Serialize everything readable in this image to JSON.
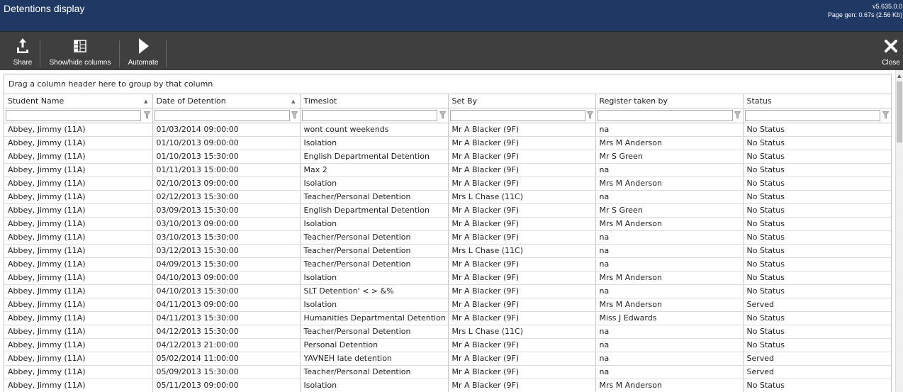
{
  "header": {
    "title": "Detentions display",
    "version": "v5.635.0.0",
    "page_gen": "Page gen: 0.67s (2.56 Kb)"
  },
  "toolbar": {
    "share": {
      "label": "Share",
      "icon": "share-icon"
    },
    "show_hide": {
      "label": "Show/hide columns",
      "icon": "columns-icon"
    },
    "automate": {
      "label": "Automate",
      "icon": "play-icon"
    },
    "close": {
      "label": "Close",
      "icon": "close-icon"
    }
  },
  "grid": {
    "group_panel": "Drag a column header here to group by that column",
    "columns": [
      {
        "label": "Student Name",
        "sorted": "asc"
      },
      {
        "label": "Date of Detention",
        "sorted": "asc"
      },
      {
        "label": "Timeslot",
        "sorted": null
      },
      {
        "label": "Set By",
        "sorted": null
      },
      {
        "label": "Register taken by",
        "sorted": null
      },
      {
        "label": "Status",
        "sorted": null
      }
    ],
    "filters": [
      "",
      "",
      "",
      "",
      "",
      ""
    ],
    "rows": [
      [
        "Abbey, Jimmy (11A)",
        "01/03/2014 09:00:00",
        "wont count weekends",
        "Mr A Blacker (9F)",
        "na",
        "No Status"
      ],
      [
        "Abbey, Jimmy (11A)",
        "01/10/2013 09:00:00",
        "Isolation",
        "Mr A Blacker (9F)",
        "Mrs M Anderson",
        "No Status"
      ],
      [
        "Abbey, Jimmy (11A)",
        "01/10/2013 15:30:00",
        "English Departmental Detention",
        "Mr A Blacker (9F)",
        "Mr S Green",
        "No Status"
      ],
      [
        "Abbey, Jimmy (11A)",
        "01/11/2013 15:00:00",
        "Max 2",
        "Mr A Blacker (9F)",
        "na",
        "No Status"
      ],
      [
        "Abbey, Jimmy (11A)",
        "02/10/2013 09:00:00",
        "Isolation",
        "Mr A Blacker (9F)",
        "Mrs M Anderson",
        "No Status"
      ],
      [
        "Abbey, Jimmy (11A)",
        "02/12/2013 15:30:00",
        "Teacher/Personal Detention",
        "Mrs L Chase (11C)",
        "na",
        "No Status"
      ],
      [
        "Abbey, Jimmy (11A)",
        "03/09/2013 15:30:00",
        "English Departmental Detention",
        "Mr A Blacker (9F)",
        "Mr S Green",
        "No Status"
      ],
      [
        "Abbey, Jimmy (11A)",
        "03/10/2013 09:00:00",
        "Isolation",
        "Mr A Blacker (9F)",
        "Mrs M Anderson",
        "No Status"
      ],
      [
        "Abbey, Jimmy (11A)",
        "03/10/2013 15:30:00",
        "Teacher/Personal Detention",
        "Mr A Blacker (9F)",
        "na",
        "No Status"
      ],
      [
        "Abbey, Jimmy (11A)",
        "03/12/2013 15:30:00",
        "Teacher/Personal Detention",
        "Mrs L Chase (11C)",
        "na",
        "No Status"
      ],
      [
        "Abbey, Jimmy (11A)",
        "04/09/2013 15:30:00",
        "Teacher/Personal Detention",
        "Mr A Blacker (9F)",
        "na",
        "No Status"
      ],
      [
        "Abbey, Jimmy (11A)",
        "04/10/2013 09:00:00",
        "Isolation",
        "Mr A Blacker (9F)",
        "Mrs M Anderson",
        "No Status"
      ],
      [
        "Abbey, Jimmy (11A)",
        "04/10/2013 15:30:00",
        "SLT Detention' < > &%",
        "Mr A Blacker (9F)",
        "na",
        "No Status"
      ],
      [
        "Abbey, Jimmy (11A)",
        "04/11/2013 09:00:00",
        "Isolation",
        "Mr A Blacker (9F)",
        "Mrs M Anderson",
        "Served"
      ],
      [
        "Abbey, Jimmy (11A)",
        "04/11/2013 15:30:00",
        "Humanities Departmental Detention",
        "Mr A Blacker (9F)",
        "Miss J Edwards",
        "No Status"
      ],
      [
        "Abbey, Jimmy (11A)",
        "04/12/2013 15:30:00",
        "Teacher/Personal Detention",
        "Mrs L Chase (11C)",
        "na",
        "No Status"
      ],
      [
        "Abbey, Jimmy (11A)",
        "04/12/2013 21:00:00",
        "Personal Detention",
        "Mr A Blacker (9F)",
        "na",
        "No Status"
      ],
      [
        "Abbey, Jimmy (11A)",
        "05/02/2014 11:00:00",
        "YAVNEH late detention",
        "Mr A Blacker (9F)",
        "na",
        "Served"
      ],
      [
        "Abbey, Jimmy (11A)",
        "05/09/2013 15:30:00",
        "Teacher/Personal Detention",
        "Mr A Blacker (9F)",
        "na",
        "Served"
      ],
      [
        "Abbey, Jimmy (11A)",
        "05/11/2013 09:00:00",
        "Isolation",
        "Mr A Blacker (9F)",
        "Mrs M Anderson",
        "No Status"
      ]
    ]
  },
  "colors": {
    "header_bg": "#1f3864",
    "toolbar_bg": "#3f3f3f"
  }
}
